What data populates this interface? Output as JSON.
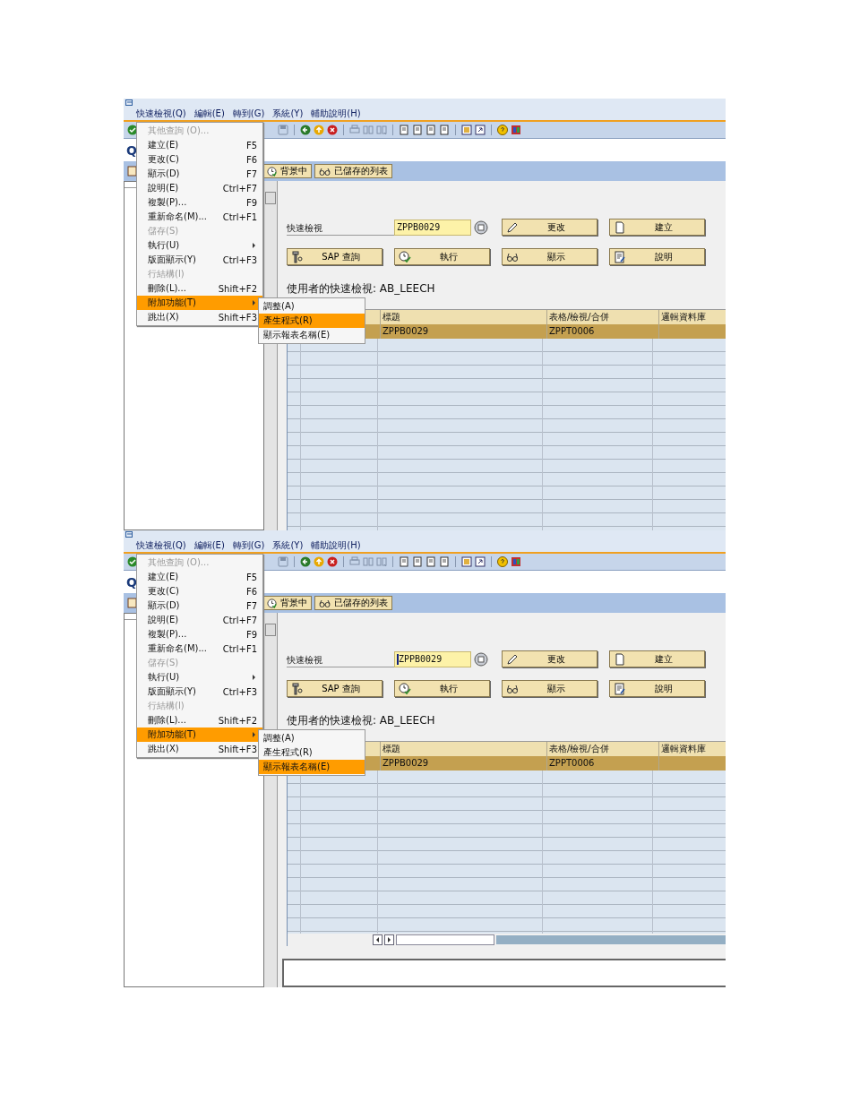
{
  "screens": [
    {
      "kind": "cropped",
      "menubar": [
        "快速檢視(Q)",
        "編輯(E)",
        "轉到(G)",
        "系統(Y)",
        "輔助說明(H)"
      ],
      "title": "Q",
      "app_toolbar_buttons": [
        {
          "label": "背景中",
          "kind": "clock"
        },
        {
          "label": "已儲存的列表",
          "kind": "glasses"
        }
      ],
      "menu": {
        "items": [
          {
            "label": "其他查詢 (O)...",
            "disabled": true,
            "has_submenu": false,
            "selected": false
          },
          {
            "label": "建立(E)",
            "shortcut": "F5",
            "disabled": false,
            "has_submenu": false,
            "selected": false
          },
          {
            "label": "更改(C)",
            "shortcut": "F6",
            "disabled": false,
            "has_submenu": false,
            "selected": false
          },
          {
            "label": "顯示(D)",
            "shortcut": "F7",
            "disabled": false,
            "has_submenu": false,
            "selected": false
          },
          {
            "label": "說明(E)",
            "shortcut": "Ctrl+F7",
            "disabled": false,
            "has_submenu": false,
            "selected": false
          },
          {
            "label": "複製(P)...",
            "shortcut": "F9",
            "disabled": false,
            "has_submenu": false,
            "selected": false
          },
          {
            "label": "重新命名(M)...",
            "shortcut": "Ctrl+F1",
            "disabled": false,
            "has_submenu": false,
            "selected": false
          },
          {
            "label": "儲存(S)",
            "disabled": true,
            "has_submenu": false,
            "selected": false
          },
          {
            "label": "執行(U)",
            "disabled": false,
            "has_submenu": true,
            "selected": false
          },
          {
            "label": "版面顯示(Y)",
            "shortcut": "Ctrl+F3",
            "disabled": false,
            "has_submenu": false,
            "selected": false
          },
          {
            "label": "行結構(I)",
            "disabled": true,
            "has_submenu": false,
            "selected": false
          },
          {
            "label": "刪除(L)...",
            "shortcut": "Shift+F2",
            "disabled": false,
            "has_submenu": false,
            "selected": false
          },
          {
            "label": "附加功能(T)",
            "disabled": false,
            "has_submenu": true,
            "selected": true
          },
          {
            "label": "跳出(X)",
            "shortcut": "Shift+F3",
            "disabled": false,
            "has_submenu": false,
            "selected": false
          }
        ]
      },
      "submenu": {
        "items": [
          {
            "label": "調整(A)",
            "selected": false
          },
          {
            "label": "產生程式(R)",
            "selected": true
          },
          {
            "label": "顯示報表名稱(E)",
            "selected": false
          }
        ]
      },
      "form": {
        "label": "快速檢視",
        "value": "ZPPB0029",
        "buttons": [
          {
            "label": "更改",
            "kind": "pencil"
          },
          {
            "label": "建立",
            "kind": "document"
          },
          {
            "label": "SAP 查詢",
            "kind": "tool"
          },
          {
            "label": "執行",
            "kind": "clock"
          },
          {
            "label": "顯示",
            "kind": "glasses"
          },
          {
            "label": "說明",
            "kind": "notes"
          }
        ]
      },
      "user_text": "使用者的快速檢視: AB_LEECH",
      "table": {
        "columns": [
          "標題",
          "表格/檢視/合併",
          "邏輯資料庫"
        ],
        "rows": [
          {
            "cells": [
              "ZPPB0029",
              "ZPPT0006"
            ],
            "selected": true
          }
        ]
      }
    },
    {
      "kind": "full",
      "menubar": [
        "快速檢視(Q)",
        "編輯(E)",
        "轉到(G)",
        "系統(Y)",
        "輔助說明(H)"
      ],
      "title": "Q",
      "app_toolbar_buttons": [
        {
          "label": "背景中",
          "kind": "clock"
        },
        {
          "label": "已儲存的列表",
          "kind": "glasses"
        }
      ],
      "menu": {
        "items": [
          {
            "label": "其他查詢 (O)...",
            "disabled": true,
            "has_submenu": false,
            "selected": false
          },
          {
            "label": "建立(E)",
            "shortcut": "F5",
            "disabled": false,
            "has_submenu": false,
            "selected": false
          },
          {
            "label": "更改(C)",
            "shortcut": "F6",
            "disabled": false,
            "has_submenu": false,
            "selected": false
          },
          {
            "label": "顯示(D)",
            "shortcut": "F7",
            "disabled": false,
            "has_submenu": false,
            "selected": false
          },
          {
            "label": "說明(E)",
            "shortcut": "Ctrl+F7",
            "disabled": false,
            "has_submenu": false,
            "selected": false
          },
          {
            "label": "複製(P)...",
            "shortcut": "F9",
            "disabled": false,
            "has_submenu": false,
            "selected": false
          },
          {
            "label": "重新命名(M)...",
            "shortcut": "Ctrl+F1",
            "disabled": false,
            "has_submenu": false,
            "selected": false
          },
          {
            "label": "儲存(S)",
            "disabled": true,
            "has_submenu": false,
            "selected": false
          },
          {
            "label": "執行(U)",
            "disabled": false,
            "has_submenu": true,
            "selected": false
          },
          {
            "label": "版面顯示(Y)",
            "shortcut": "Ctrl+F3",
            "disabled": false,
            "has_submenu": false,
            "selected": false
          },
          {
            "label": "行結構(I)",
            "disabled": true,
            "has_submenu": false,
            "selected": false
          },
          {
            "label": "刪除(L)...",
            "shortcut": "Shift+F2",
            "disabled": false,
            "has_submenu": false,
            "selected": false
          },
          {
            "label": "附加功能(T)",
            "disabled": false,
            "has_submenu": true,
            "selected": true
          },
          {
            "label": "跳出(X)",
            "shortcut": "Shift+F3",
            "disabled": false,
            "has_submenu": false,
            "selected": false
          }
        ]
      },
      "submenu": {
        "items": [
          {
            "label": "調整(A)",
            "selected": false
          },
          {
            "label": "產生程式(R)",
            "selected": false
          },
          {
            "label": "顯示報表名稱(E)",
            "selected": true
          }
        ]
      },
      "form": {
        "label": "快速檢視",
        "value": "ZPPB0029",
        "buttons": [
          {
            "label": "更改",
            "kind": "pencil"
          },
          {
            "label": "建立",
            "kind": "document"
          },
          {
            "label": "SAP 查詢",
            "kind": "tool"
          },
          {
            "label": "執行",
            "kind": "clock"
          },
          {
            "label": "顯示",
            "kind": "glasses"
          },
          {
            "label": "說明",
            "kind": "notes"
          }
        ]
      },
      "user_text": "使用者的快速檢視: AB_LEECH",
      "table": {
        "columns": [
          "標題",
          "表格/檢視/合併",
          "邏輯資料庫"
        ],
        "rows": [
          {
            "cells": [
              "ZPPB0029",
              "ZPPT0006"
            ],
            "selected": true
          }
        ]
      }
    }
  ]
}
